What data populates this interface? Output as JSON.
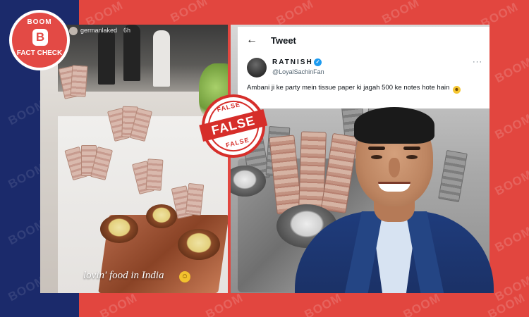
{
  "brand": {
    "watermark": "BOOM",
    "logo_top": "BOOM",
    "logo_letter": "B",
    "logo_bottom": "FACT CHECK",
    "accent": "#e34a45",
    "navy": "#1b2a6b"
  },
  "verdict_stamp": {
    "label": "FALSE",
    "ring_top": "FALSE",
    "ring_bottom": "FALSE",
    "color": "#d62e2a"
  },
  "left_post": {
    "username": "germanlaked",
    "time": "6h",
    "caption": "lovin' food in India",
    "caption_emoji": "relieved-face-emoji"
  },
  "tweet": {
    "header_title": "Tweet",
    "back_icon": "arrow-left-icon",
    "display_name": "RATNISH",
    "handle": "@LoyalSachinFan",
    "more_icon": "more-horizontal-icon",
    "text": "Ambani ji ke party mein tissue paper ki jagah 500 ke notes hote hain",
    "emoji": "crying-laughing-emoji",
    "verified_color": "#1d9bf0"
  }
}
